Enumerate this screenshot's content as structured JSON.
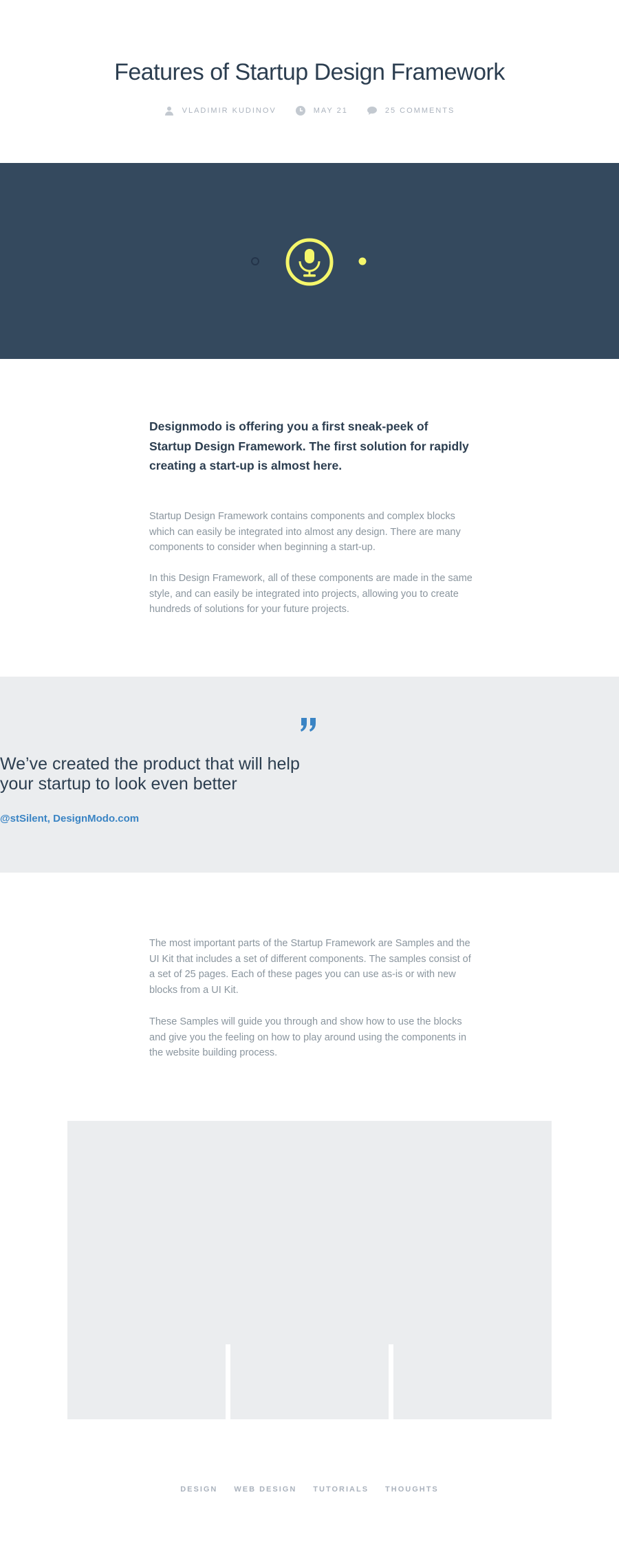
{
  "post": {
    "title": "Features of Startup Design Framework",
    "meta": {
      "author": "VLADIMIR KUDINOV",
      "date": "MAY 21",
      "comments": "25 COMMENTS"
    },
    "lead": "Designmodo is offering you a first sneak-peek of Startup Design Framework. The first solution for rapidly creating a start-up is almost here.",
    "paragraphs": [
      "Startup Design Framework contains components and complex blocks which can easily be integrated into almost any design. There are many components to consider when beginning a start-up.",
      "In this Design Framework, all of these components are made in the same style, and can easily be integrated into projects, allowing you to create hundreds of solutions for your future projects.",
      "The most important parts of the Startup Framework are Samples and the UI Kit that includes a set of different components. The samples consist of a set of 25 pages. Each of these pages you can use as-is or with new blocks from a UI Kit.",
      "These Samples will guide you through and show how to use the blocks and give you the feeling on how to play around using the components in the website building process."
    ]
  },
  "quote": {
    "text_line1": "We’ve created the product that will help",
    "text_line2": "your startup to look even better",
    "author": "@stSilent, DesignModo.com"
  },
  "tags": [
    "DESIGN",
    "WEB DESIGN",
    "TUTORIALS",
    "THOUGHTS"
  ],
  "icons": {
    "author": "user-icon",
    "date": "clock-icon",
    "comments": "speech-bubble-icon",
    "hero": "microphone-icon",
    "quote": "quote-mark-icon"
  },
  "colors": {
    "hero_bg": "#34495e",
    "accent_yellow": "#f5f66b",
    "link_blue": "#3a84c4",
    "band_gray": "#ebedef",
    "title_text": "#2c3e50",
    "body_text": "#8a959e",
    "meta_text": "#aab2bd"
  }
}
